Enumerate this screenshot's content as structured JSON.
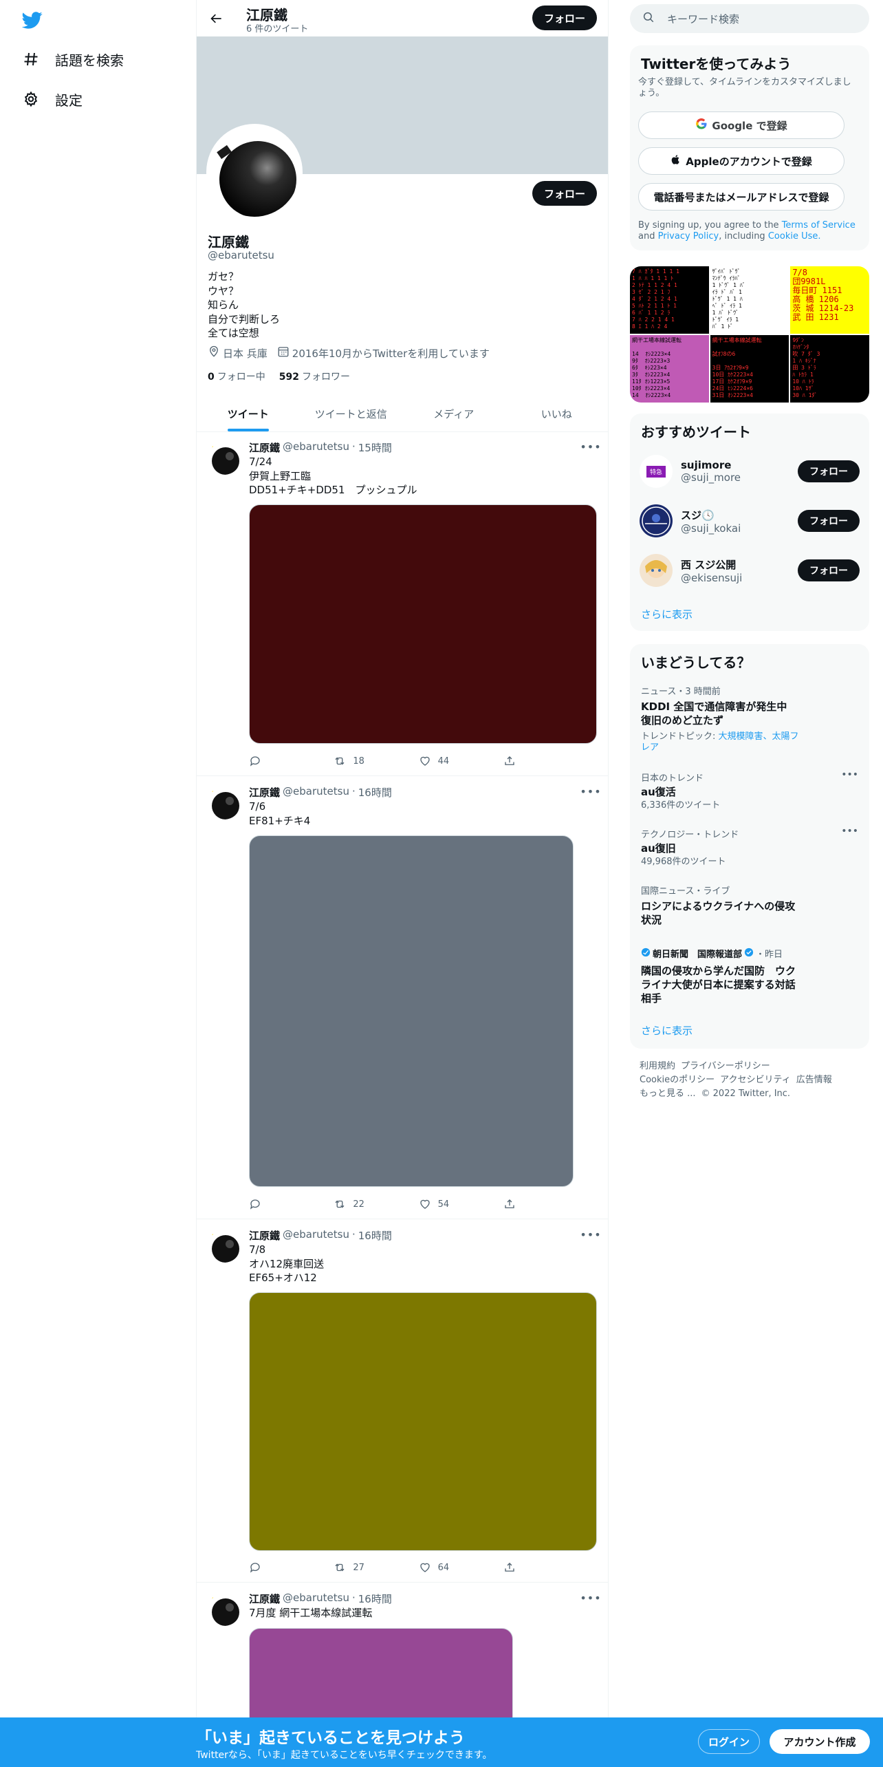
{
  "nav": {
    "items": [
      {
        "label": "話題を検索",
        "icon": "hashtag-icon"
      },
      {
        "label": "設定",
        "icon": "gear-icon"
      }
    ]
  },
  "header": {
    "name": "江原鐵",
    "tweet_count": "6 件のツイート",
    "follow_label": "フォロー"
  },
  "profile": {
    "name": "江原鐵",
    "handle": "@ebarutetsu",
    "follow_label": "フォロー",
    "bio": "ガセ？\nウヤ？\n知らん\n自分で判断しろ\n全ては空想",
    "location": "日本 兵庫",
    "joined": "2016年10月からTwitterを利用しています",
    "following_count": "0",
    "following_label": "フォロー中",
    "followers_count": "592",
    "followers_label": "フォロワー"
  },
  "tabs": [
    "ツイート",
    "ツイートと返信",
    "メディア",
    "いいね"
  ],
  "tweets": [
    {
      "name": "江原鐵",
      "handle": "@ebarutetsu",
      "time": "15時間",
      "text": "7/24\n伊賀上野工臨\nDD51+チキ+DD51　プッシュプル",
      "retweets": "18",
      "likes": "44",
      "media_color": "#430a0c"
    },
    {
      "name": "江原鐵",
      "handle": "@ebarutetsu",
      "time": "16時間",
      "text": "7/6\nEF81+チキ4",
      "retweets": "22",
      "likes": "54",
      "media_color": "#67727e"
    },
    {
      "name": "江原鐵",
      "handle": "@ebarutetsu",
      "time": "16時間",
      "text": "7/8\nオハ12廃車回送\nEF65+オハ12",
      "retweets": "27",
      "likes": "64",
      "media_color": "#7d7800"
    },
    {
      "name": "江原鐵",
      "handle": "@ebarutetsu",
      "time": "16時間",
      "text": "7月度 網干工場本線試運転",
      "retweets": "",
      "likes": "",
      "media_color": "#974895"
    }
  ],
  "search": {
    "placeholder": "キーワード検索"
  },
  "signup": {
    "title": "Twitterを使ってみよう",
    "subtitle": "今すぐ登録して、タイムラインをカスタマイズしましょう。",
    "google": "Google で登録",
    "apple": "Appleのアカウントで登録",
    "phone": "電話番号またはメールアドレスで登録",
    "terms_prefix": "By signing up, you agree to the",
    "terms_link": "Terms of Service",
    "terms_and": "and",
    "privacy_link": "Privacy Policy",
    "including": ", including",
    "cookie_link": "Cookie Use."
  },
  "media_grid": {
    "cells": [
      {
        "bg": "#000000",
        "fg": "#ff3030",
        "text": "7 ﾊ ｶﾞﾀ 1 1 1 1\n1 ﾊ ﾊ 1 1 1 ﾄ\n2 ﾄﾃ 1 1 2 4 1\n3 ｾﾞ 2 2 1 ﾌ\n4 ﾀﾞ 2 1 2 4 1\n5 ﾊﾄ 2 1 1 ﾄ 1\n6 ﾊﾞ 1 1 2 ﾗ\n7 ﾊ 2 2 1 4 1\n8 ｴ 1 ﾊ 2 4"
      },
      {
        "bg": "#ffffff",
        "fg": "#000000",
        "text": "ｻﾞｲﾊﾞ ﾄﾞｳﾞ\nﾏﾝﾃﾞｳ ｲﾗﾊﾞ\n1 ﾄﾞｳﾞ 1 ﾊﾞ\nｲﾗ ﾄﾞ ﾊﾞ 1\nﾄﾞｳﾞ 1 1 ﾊ\nﾍﾞ ﾄﾞ ｲﾗ 1\n1 ﾊﾞ ﾄﾞｳﾞ\nﾄﾞｳﾞ ｲﾗ 1\nﾊﾞ 1 ﾄﾞ"
      },
      {
        "bg": "#ffff00",
        "fg": "#cc0000",
        "text": "7/8\n団9981L\n毎日町 1151\n高 橋 1206\n茨 城 1214-23\n武 田 1231"
      },
      {
        "bg": "#c05ab5",
        "fg": "#000000",
        "text": "網干工場本線試運転\n\n14  ｵｼ2223×4\n9ﾀ  ｵｼ2223×3\n6ﾀ  ｷｼ223×4\n3ﾀ  ｵｼ2223×4\n11ﾀ ｵｼ1223×5\n10ﾀ ｵｼ2223×4\n14  ｵｼ2223×4"
      },
      {
        "bg": "#000000",
        "fg": "#ff3030",
        "text": "網干工場本線試運転\n\n試ｵﾌ8の6\n\n3日 ｱｶ2ｵﾌ9×9\n10日 ｶｹ2223×4\n17日 ｶｹ2ｵﾌ9×9\n24日 ﾋｼ2224×6\n31日 ｵｼ2223×4"
      },
      {
        "bg": "#000000",
        "fg": "#ff3030",
        "text": "9ﾀﾞﾝ\nｵﾊｹﾞﾝﾀ\n吹 7 ﾀﾞ 3\n1 ﾊ ｷｼﾞﾅ\n田 3 ﾄﾞﾗ\nﾊ ﾄｶﾗ 1\n10 ﾊ ﾄﾗ\n10ﾊ 1ｻﾞ\n30 ﾊ 1ﾀﾞ"
      }
    ]
  },
  "recommend": {
    "title": "おすすめツイート",
    "follow_label": "フォロー",
    "users": [
      {
        "name": "sujimore",
        "handle": "@suji_more",
        "badge": "特急"
      },
      {
        "name": "スジ🕓",
        "handle": "@suji_kokai",
        "badge": ""
      },
      {
        "name": "西 スジ公開",
        "handle": "@ekisensuji",
        "badge": ""
      }
    ],
    "more": "さらに表示"
  },
  "trends": {
    "title": "いまどうしてる？",
    "items": [
      {
        "meta": "ニュース・3 時間前",
        "title": "KDDI 全国で通信障害が発生中 復旧のめど立たず",
        "sub_prefix": "トレンドトピック: ",
        "sub_link": "大規模障害、太陽フレア",
        "has_more": false
      },
      {
        "meta": "日本のトレンド",
        "title": "au復活",
        "sub_prefix": "6,336件のツイート",
        "sub_link": "",
        "has_more": true
      },
      {
        "meta": "テクノロジー・トレンド",
        "title": "au復旧",
        "sub_prefix": "49,968件のツイート",
        "sub_link": "",
        "has_more": true
      },
      {
        "meta": "国際ニュース・ライブ",
        "title": "ロシアによるウクライナへの侵攻状況",
        "sub_prefix": "",
        "sub_link": "",
        "has_more": false
      },
      {
        "meta_name": "朝日新聞　国際報道部",
        "meta": "・昨日",
        "title": "隣国の侵攻から学んだ国防　ウクライナ大使が日本に提案する対話相手",
        "sub_prefix": "",
        "sub_link": "",
        "has_more": false
      }
    ],
    "more": "さらに表示"
  },
  "footer": {
    "links": [
      "利用規約",
      "プライバシーポリシー",
      "Cookieのポリシー",
      "アクセシビリティ",
      "広告情報",
      "もっと見る ...",
      "© 2022 Twitter, Inc."
    ]
  },
  "bottom_bar": {
    "title": "「いま」起きていることを見つけよう",
    "subtitle": "Twitterなら、「いま」起きていることをいち早くチェックできます。",
    "login": "ログイン",
    "signup": "アカウント作成"
  },
  "colors": {
    "accent": "#1d9bf0",
    "banner": "#cfd9de",
    "text": "#0f1419",
    "muted": "#536471"
  }
}
